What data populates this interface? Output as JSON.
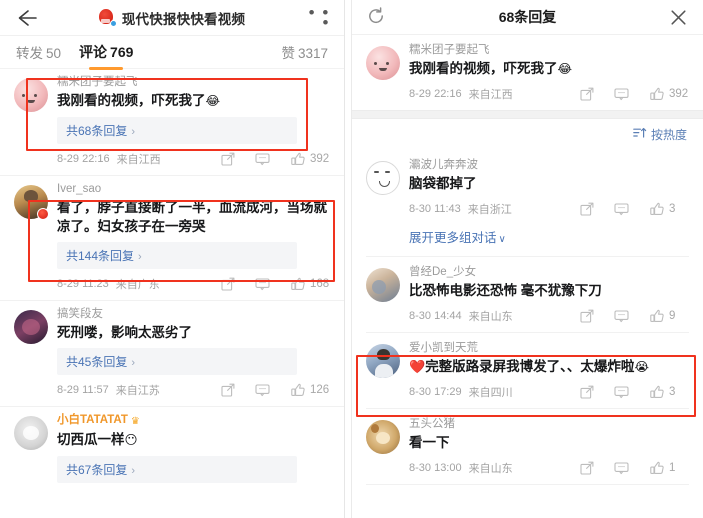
{
  "left_panel": {
    "header": {
      "back_icon": "back-arrow-icon",
      "logo_icon": "site-logo-icon",
      "verified_badge_icon": "verified-badge-icon",
      "title": "现代快报快快看视频",
      "more_icon": "more-options-icon",
      "more_label": "• • •"
    },
    "tabs": [
      {
        "label": "转发",
        "count": "50",
        "active": false
      },
      {
        "label": "评论",
        "count": "769",
        "active": true
      },
      {
        "label": "赞",
        "count": "3317",
        "active": false
      }
    ],
    "accent_color": "#ff9a2e",
    "highlight_color": "#f0321e",
    "comments": [
      {
        "username": "糯米团子要起飞",
        "vip": false,
        "text": "我刚看的视频，吓死我了",
        "emoji": "😂",
        "reply_label": "共68条回复",
        "reply_chevron": "›",
        "time": "8-29 22:16",
        "location": "来自江西",
        "likes": "392",
        "avatar": "a-dumpling",
        "avatar_badge": false,
        "highlighted": true
      },
      {
        "username": "Iver_sao",
        "vip": false,
        "text": "看了，脖子直接断了一半，血流成河，当场就凉了。妇女孩子在一旁哭",
        "emoji": "",
        "reply_label": "共144条回复",
        "reply_chevron": "›",
        "time": "8-29 11:23",
        "location": "来自广东",
        "likes": "168",
        "avatar": "a-man",
        "avatar_badge": true,
        "highlighted": true
      },
      {
        "username": "搞笑段友",
        "vip": false,
        "text": "死刑喽，影响太恶劣了",
        "emoji": "",
        "reply_label": "共45条回复",
        "reply_chevron": "›",
        "time": "8-29 11:57",
        "location": "来自江苏",
        "likes": "126",
        "avatar": "a-dark",
        "avatar_badge": false,
        "highlighted": false
      },
      {
        "username": "小白TATATAT",
        "vip": true,
        "crown_icon": "crown-badge-icon",
        "text": "切西瓜一样",
        "emoji": "😶",
        "reply_label": "共67条回复",
        "reply_chevron": "›",
        "time": "",
        "location": "",
        "likes": "",
        "avatar": "a-cat",
        "avatar_badge": false,
        "highlighted": false
      }
    ]
  },
  "right_panel": {
    "header": {
      "refresh_icon": "refresh-icon",
      "title": "68条回复",
      "close_icon": "close-icon"
    },
    "sort": {
      "icon": "sort-icon",
      "label": "按热度"
    },
    "expand_link": {
      "label": "展开更多组对话",
      "chevron": "∨"
    },
    "replies": [
      {
        "username": "糯米团子要起飞",
        "text": "我刚看的视频，吓死我了",
        "emoji": "😂",
        "time": "8-29 22:16",
        "location": "来自江西",
        "likes": "392",
        "avatar": "a-dumpling",
        "highlighted": false,
        "is_root": true
      },
      {
        "username": "灞波儿奔奔波",
        "text": "脑袋都掉了",
        "emoji": "",
        "time": "8-30 11:43",
        "location": "来自浙江",
        "likes": "3",
        "avatar": "a-face",
        "highlighted": false,
        "has_expand": true
      },
      {
        "username": "曾经De_少女",
        "text": "比恐怖电影还恐怖 毫不犹豫下刀",
        "emoji": "",
        "time": "8-30 14:44",
        "location": "来自山东",
        "likes": "9",
        "avatar": "a-couple",
        "highlighted": false
      },
      {
        "username": "爱小凯到天荒",
        "text": "完整版路录屏我博发了、、太爆炸啦",
        "prefix_emoji": "❤️",
        "emoji": "😭",
        "time": "8-30 17:29",
        "location": "来自四川",
        "likes": "3",
        "avatar": "a-boy",
        "highlighted": true
      },
      {
        "username": "五头公猪",
        "text": "看一下",
        "emoji": "",
        "time": "8-30 13:00",
        "location": "来自山东",
        "likes": "1",
        "avatar": "a-dog",
        "highlighted": false
      }
    ]
  },
  "icons": {
    "share": "share-icon",
    "comment": "comment-icon",
    "like": "thumbs-up-icon"
  }
}
